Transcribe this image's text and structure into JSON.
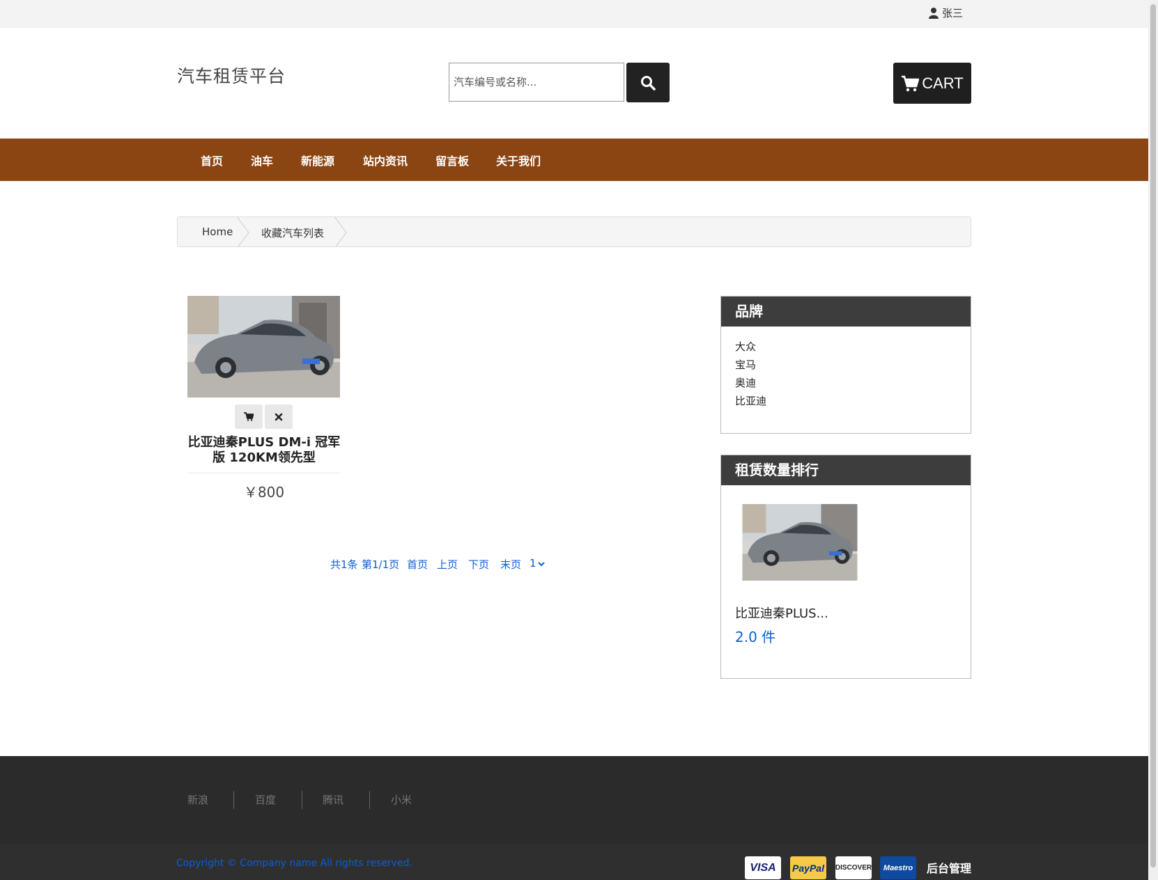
{
  "header": {
    "user_name": "张三",
    "logo": "汽车租赁平台",
    "search_placeholder": "汽车编号或名称...",
    "cart_label": "CART"
  },
  "nav": {
    "items": [
      {
        "label": "首页"
      },
      {
        "label": "油车"
      },
      {
        "label": "新能源"
      },
      {
        "label": "站内资讯"
      },
      {
        "label": "留言板"
      },
      {
        "label": "关于我们"
      }
    ]
  },
  "breadcrumb": {
    "home": "Home",
    "current": "收藏汽车列表"
  },
  "products": [
    {
      "name": "比亚迪秦PLUS DM-i 冠军版 120KM领先型",
      "price": "￥800"
    }
  ],
  "pagination": {
    "total": "共1条",
    "page_info": "第1/1页",
    "first": "首页",
    "prev": "上页",
    "next": "下页",
    "last": "末页",
    "select_value": "1"
  },
  "brands": {
    "title": "品牌",
    "items": [
      "大众",
      "宝马",
      "奥迪",
      "比亚迪"
    ]
  },
  "ranking": {
    "title": "租赁数量排行",
    "items": [
      {
        "name": "比亚迪秦PLUS...",
        "count": "2.0 件"
      }
    ]
  },
  "footer": {
    "links": [
      "新浪",
      "百度",
      "腾讯",
      "小米"
    ],
    "copyright": "Copyright © Company name All rights reserved.",
    "payments": [
      "VISA",
      "PayPal",
      "DISCOVER",
      "Maestro"
    ],
    "admin": "后台管理"
  },
  "colors": {
    "nav_bg": "#8b4513",
    "dark_panel": "#3d3d3d",
    "link_blue": "#0b5ed7",
    "footer_bg": "#2b2b2b"
  }
}
